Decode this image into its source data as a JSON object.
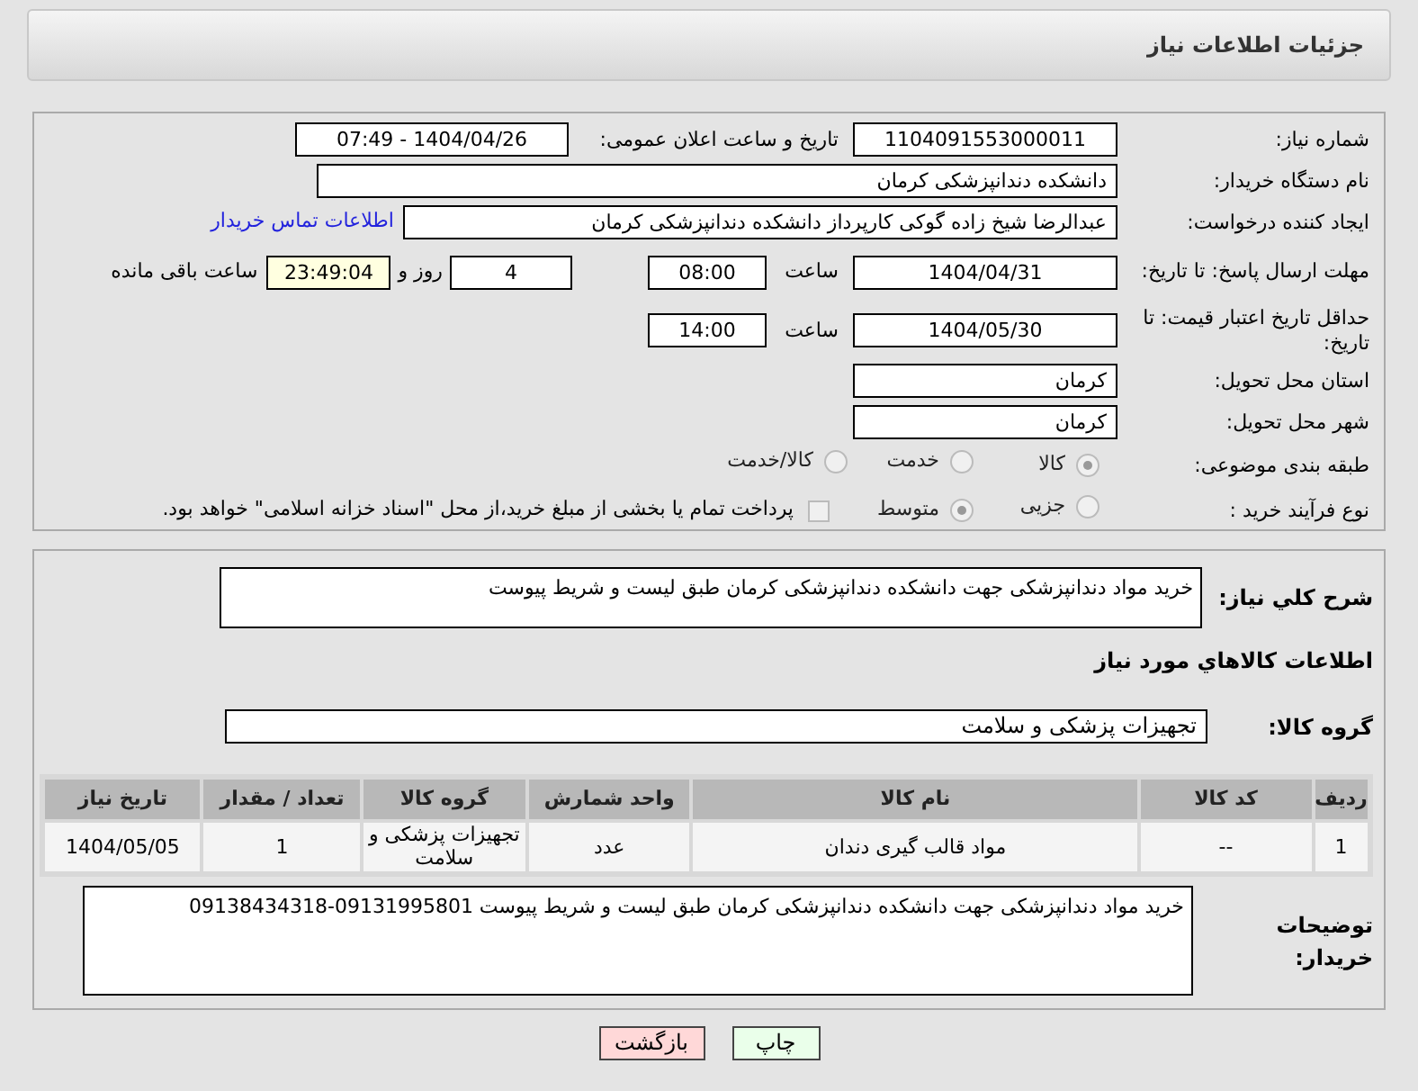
{
  "header": {
    "title": "جزئیات اطلاعات نیاز"
  },
  "need_number": {
    "label": "شماره نیاز:",
    "value": "1104091553000011"
  },
  "announce": {
    "label": "تاریخ و ساعت اعلان عمومی:",
    "value": "1404/04/26 - 07:49"
  },
  "buyer_org": {
    "label": "نام دستگاه خریدار:",
    "value": "دانشکده دندانپزشکی کرمان"
  },
  "requester": {
    "label": "ایجاد کننده درخواست:",
    "value": "عبدالرضا شیخ زاده گوکی کارپرداز دانشکده دندانپزشکی کرمان",
    "link": "اطلاعات تماس خریدار"
  },
  "deadline": {
    "label": "مهلت ارسال پاسخ: تا تاریخ:",
    "date": "1404/04/31",
    "time_label": "ساعت",
    "time": "08:00",
    "days": "4",
    "days_label": "روز و",
    "remaining": "23:49:04",
    "remaining_label": "ساعت باقی مانده"
  },
  "price_validity": {
    "label": "حداقل تاریخ اعتبار قیمت: تا تاریخ:",
    "date": "1404/05/30",
    "time_label": "ساعت",
    "time": "14:00"
  },
  "province": {
    "label": "استان محل تحویل:",
    "value": "کرمان"
  },
  "city": {
    "label": "شهر محل تحویل:",
    "value": "کرمان"
  },
  "category": {
    "label": "طبقه بندی موضوعی:",
    "options": [
      {
        "label": "کالا",
        "selected": true
      },
      {
        "label": "خدمت",
        "selected": false
      },
      {
        "label": "کالا/خدمت",
        "selected": false
      }
    ]
  },
  "process": {
    "label": "نوع فرآیند خرید :",
    "options": [
      {
        "label": "جزیی",
        "selected": false
      },
      {
        "label": "متوسط",
        "selected": true
      }
    ],
    "payment": {
      "label": "پرداخت تمام یا بخشی از مبلغ خرید،از محل \"اسناد خزانه اسلامی\" خواهد بود.",
      "checked": false
    }
  },
  "description": {
    "label": "شرح کلي نياز:",
    "value": "خرید مواد دندانپزشکی جهت دانشکده دندانپزشکی کرمان طبق لیست و شریط پیوست"
  },
  "items_heading": "اطلاعات کالاهاي مورد نياز",
  "goods_group": {
    "label": "گروه کالا:",
    "value": "تجهیزات پزشکی و سلامت"
  },
  "table": {
    "columns": [
      "ردیف",
      "کد کالا",
      "نام کالا",
      "واحد شمارش",
      "گروه کالا",
      "تعداد / مقدار",
      "تاریخ نیاز"
    ],
    "rows": [
      [
        "1",
        "--",
        "مواد قالب گیری دندان",
        "عدد",
        "تجهیزات پزشکی و سلامت",
        "1",
        "1404/05/05"
      ]
    ]
  },
  "buyer_notes": {
    "label": "توضیحات خریدار:",
    "value": "خرید مواد دندانپزشکی جهت دانشکده دندانپزشکی کرمان طبق لیست و شریط پیوست 09131995801-09138434318"
  },
  "buttons": [
    {
      "label": "چاپ",
      "kind": "print"
    },
    {
      "label": "بازگشت",
      "kind": "back"
    }
  ]
}
